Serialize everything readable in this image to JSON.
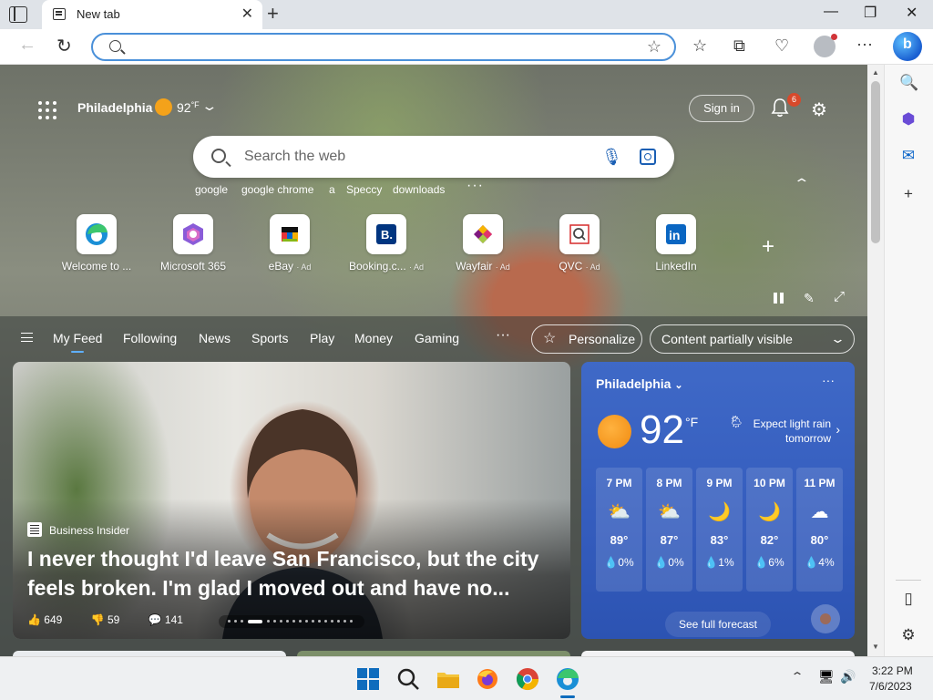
{
  "browser": {
    "tab_title": "New tab",
    "address_value": "",
    "address_placeholder": ""
  },
  "header": {
    "location": "Philadelphia",
    "temp": "92",
    "temp_unit": "°F",
    "signin": "Sign in",
    "notification_count": "6"
  },
  "search": {
    "placeholder": "Search the web",
    "trending": [
      "google",
      "google chrome",
      "a",
      "Speccy",
      "downloads"
    ]
  },
  "tiles": [
    {
      "label": "Welcome to ...",
      "ad": ""
    },
    {
      "label": "Microsoft 365",
      "ad": ""
    },
    {
      "label": "eBay",
      "ad": "· Ad"
    },
    {
      "label": "Booking.c...",
      "ad": "· Ad"
    },
    {
      "label": "Wayfair",
      "ad": "· Ad"
    },
    {
      "label": "QVC",
      "ad": "· Ad"
    },
    {
      "label": "LinkedIn",
      "ad": ""
    }
  ],
  "feed_nav": {
    "tabs": [
      "My Feed",
      "Following",
      "News",
      "Sports",
      "Play",
      "Money",
      "Gaming"
    ],
    "more": "···",
    "personalize": "Personalize",
    "content_visibility": "Content partially visible"
  },
  "hero": {
    "source": "Business Insider",
    "title": "I never thought I'd leave San Francisco, but the city feels broken. I'm glad I moved out and have no...",
    "likes": "649",
    "dislikes": "59",
    "comments": "141"
  },
  "weather": {
    "location": "Philadelphia",
    "temp": "92",
    "unit": "°F",
    "forecast_text": "Expect light rain tomorrow",
    "hours": [
      {
        "time": "7 PM",
        "icon": "partly-sunny",
        "temp": "89°",
        "precip": "0%"
      },
      {
        "time": "8 PM",
        "icon": "partly-sunny",
        "temp": "87°",
        "precip": "0%"
      },
      {
        "time": "9 PM",
        "icon": "moon",
        "temp": "83°",
        "precip": "1%"
      },
      {
        "time": "10 PM",
        "icon": "moon",
        "temp": "82°",
        "precip": "6%"
      },
      {
        "time": "11 PM",
        "icon": "partly-cloudy-night",
        "temp": "80°",
        "precip": "4%"
      }
    ],
    "see_full": "See full forecast"
  },
  "taskbar": {
    "time": "3:22 PM",
    "date": "7/6/2023"
  }
}
